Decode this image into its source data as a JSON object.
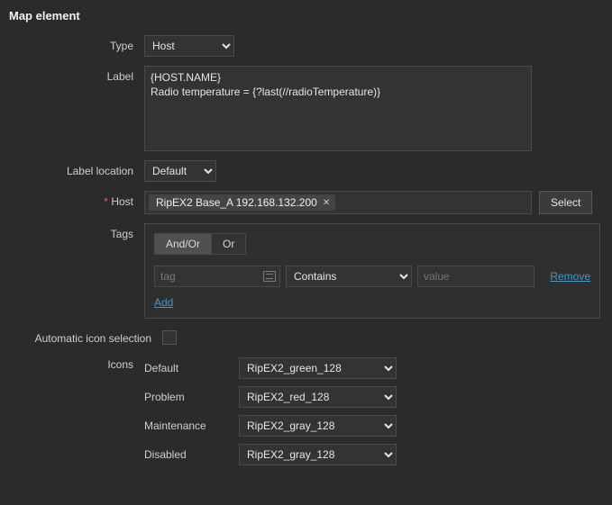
{
  "section_title": "Map element",
  "labels": {
    "type": "Type",
    "label": "Label",
    "label_location": "Label location",
    "host": "Host",
    "tags": "Tags",
    "auto_icon": "Automatic icon selection",
    "icons": "Icons"
  },
  "type_select": {
    "value": "Host",
    "options": [
      "Host"
    ]
  },
  "label_text": "{HOST.NAME}\nRadio temperature = {?last(//radioTemperature)}",
  "label_location_select": {
    "value": "Default",
    "options": [
      "Default"
    ]
  },
  "host_chip": "RipEX2 Base_A 192.168.132.200",
  "host_select_btn": "Select",
  "tags_box": {
    "seg_andor": "And/Or",
    "seg_or": "Or",
    "tag_placeholder": "tag",
    "operator": {
      "value": "Contains",
      "options": [
        "Contains"
      ]
    },
    "value_placeholder": "value",
    "remove": "Remove",
    "add": "Add"
  },
  "auto_icon_checked": false,
  "icons": {
    "rows": [
      {
        "label": "Default",
        "value": "RipEX2_green_128"
      },
      {
        "label": "Problem",
        "value": "RipEX2_red_128"
      },
      {
        "label": "Maintenance",
        "value": "RipEX2_gray_128"
      },
      {
        "label": "Disabled",
        "value": "RipEX2_gray_128"
      }
    ]
  }
}
